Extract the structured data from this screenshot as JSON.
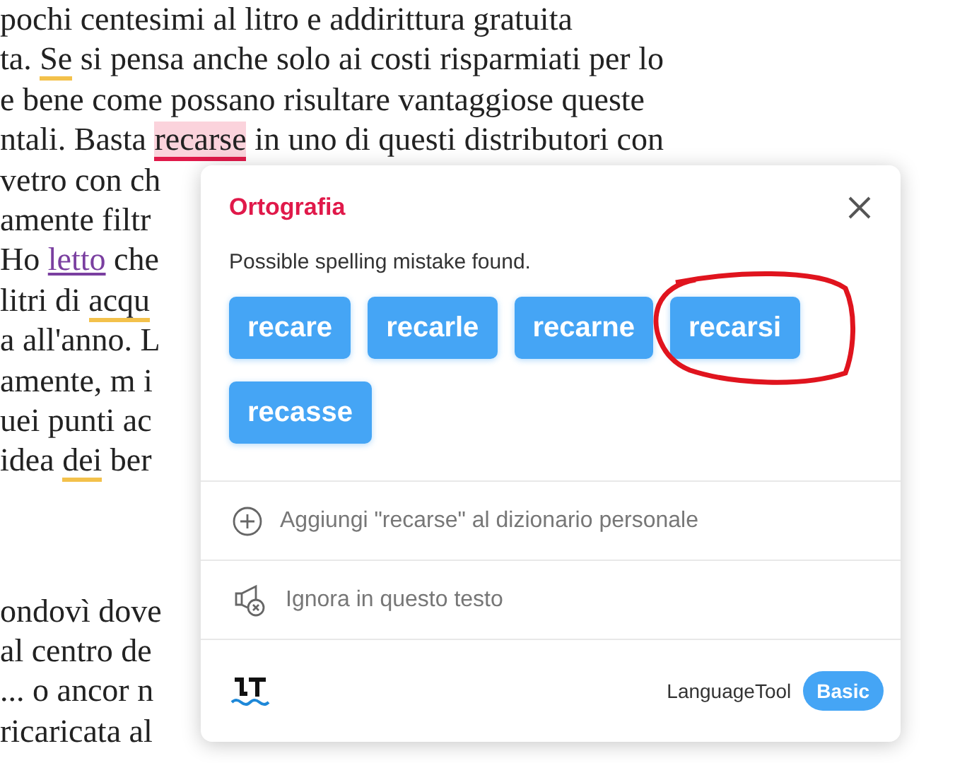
{
  "document": {
    "paragraphs": [
      {
        "lines": [
          [
            {
              "kind": "plain",
              "text": "pochi centesimi al litro e addirittura gratuita"
            }
          ],
          [
            {
              "kind": "plain",
              "text": "ta. "
            },
            {
              "kind": "warning",
              "text": "Se"
            },
            {
              "kind": "plain",
              "text": " si pensa anche solo ai costi risparmiati per lo"
            }
          ],
          [
            {
              "kind": "plain",
              "text": "e bene come possano risultare vantaggiose queste"
            }
          ],
          [
            {
              "kind": "plain",
              "text": "ntali. Basta "
            },
            {
              "kind": "error",
              "text": "recarse"
            },
            {
              "kind": "plain",
              "text": " in uno di questi distributori con"
            }
          ],
          [
            {
              "kind": "plain",
              "text": "vetro con ch"
            }
          ],
          [
            {
              "kind": "plain",
              "text": "amente filtr"
            }
          ],
          [
            {
              "kind": "plain",
              "text": "Ho "
            },
            {
              "kind": "link",
              "text": "letto"
            },
            {
              "kind": "plain",
              "text": " che"
            }
          ],
          [
            {
              "kind": "plain",
              "text": "litri di "
            },
            {
              "kind": "warning",
              "text": "acqu"
            }
          ],
          [
            {
              "kind": "plain",
              "text": "a all'anno. L"
            }
          ],
          [
            {
              "kind": "plain",
              "text": "amente, m i"
            }
          ],
          [
            {
              "kind": "plain",
              "text": "uei punti ac"
            }
          ],
          [
            {
              "kind": "plain",
              "text": "idea "
            },
            {
              "kind": "warning",
              "text": "dei"
            },
            {
              "kind": "plain",
              "text": " ber"
            }
          ]
        ]
      },
      {
        "lines": [
          [
            {
              "kind": "plain",
              "text": "ondovì dove"
            }
          ],
          [
            {
              "kind": "plain",
              "text": "al centro de"
            }
          ],
          [
            {
              "kind": "plain",
              "text": "... o ancor n"
            }
          ],
          [
            {
              "kind": "plain",
              "text": "ricaricata al"
            }
          ]
        ]
      }
    ]
  },
  "popup": {
    "title": "Ortografia",
    "message": "Possible spelling mistake found.",
    "suggestions": [
      {
        "label": "recare",
        "circled": false
      },
      {
        "label": "recarle",
        "circled": false
      },
      {
        "label": "recarne",
        "circled": false
      },
      {
        "label": "recarsi",
        "circled": true
      },
      {
        "label": "recasse",
        "circled": false
      }
    ],
    "actions": [
      {
        "kind": "add",
        "label": "Aggiungi \"recarse\" al dizionario personale"
      },
      {
        "kind": "ignore",
        "label": "Ignora in questo testo"
      }
    ],
    "footer": {
      "brand": "LanguageTool",
      "plan": "Basic"
    }
  }
}
